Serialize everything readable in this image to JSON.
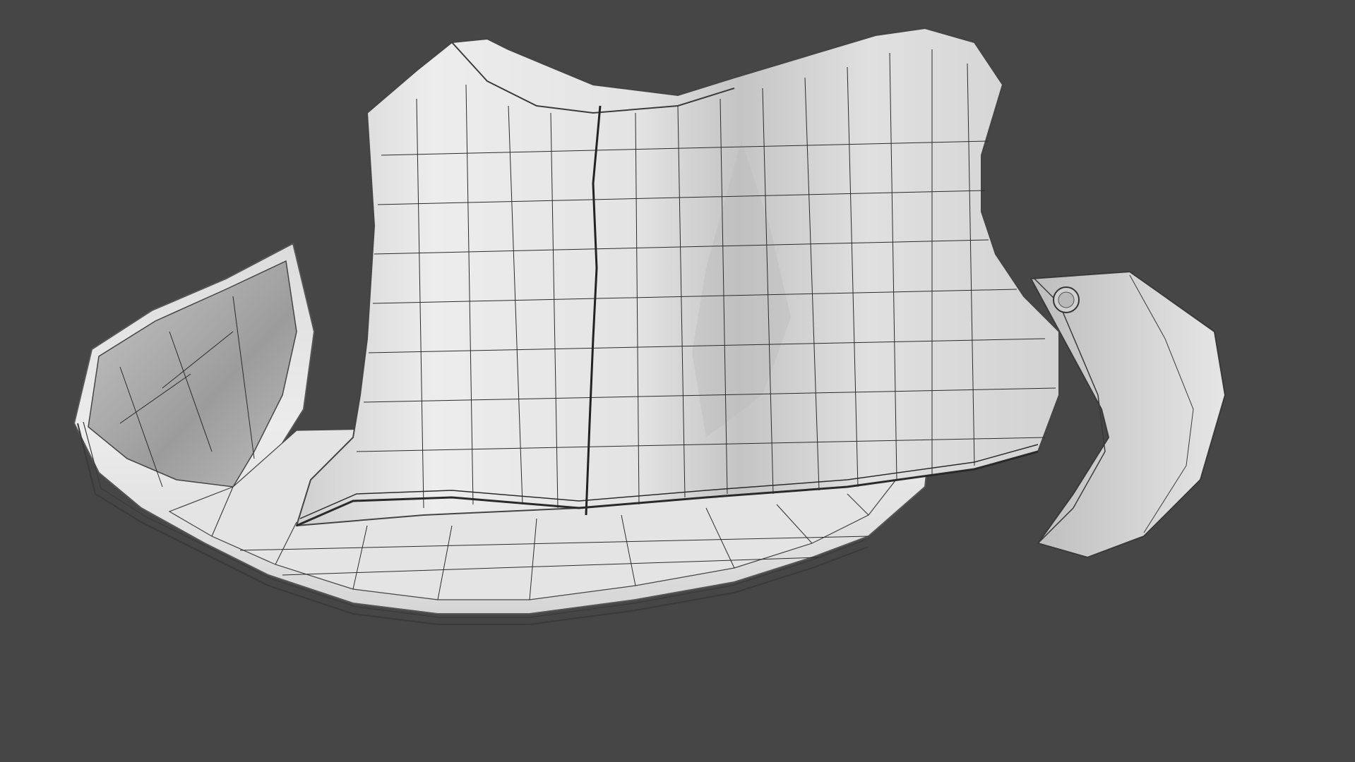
{
  "scene": {
    "subject": "fedora-hat-wireframe",
    "background_color": "#464646",
    "surface_color": "#d9d9d9",
    "wire_color": "#2b2b2b",
    "shadow_color": "#8e8e8e"
  }
}
